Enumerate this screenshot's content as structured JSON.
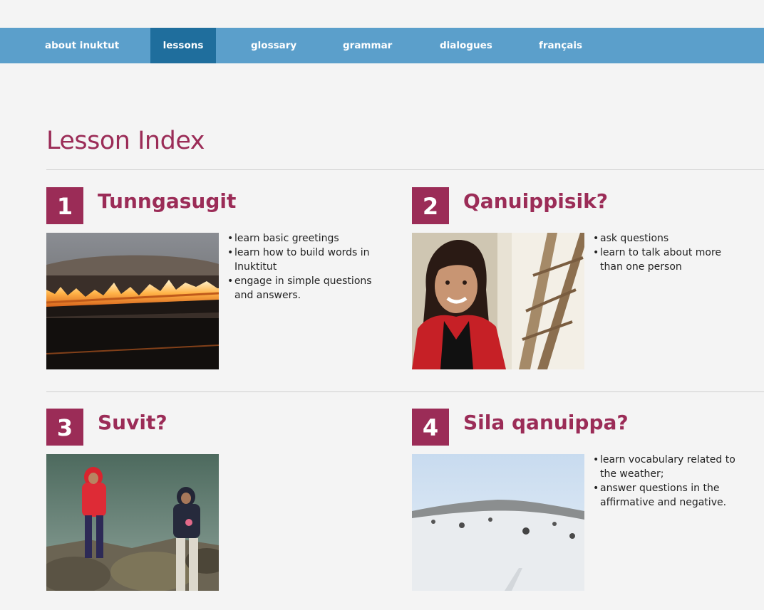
{
  "nav": {
    "items": [
      {
        "label": "about inuktut",
        "active": false
      },
      {
        "label": "lessons",
        "active": true
      },
      {
        "label": "glossary",
        "active": false
      },
      {
        "label": "grammar",
        "active": false
      },
      {
        "label": "dialogues",
        "active": false
      },
      {
        "label": "français",
        "active": false
      }
    ]
  },
  "page": {
    "title": "Lesson Index"
  },
  "lessons": [
    {
      "number": "1",
      "title": "Tunngasugit",
      "image_icon": "flame-photo",
      "bullets": [
        "learn basic greetings",
        "learn how to build words in Inuktitut",
        "engage in simple questions and answers."
      ]
    },
    {
      "number": "2",
      "title": "Qanuippisik?",
      "image_icon": "woman-portrait-photo",
      "bullets": [
        "ask questions",
        "learn to talk about more than one person"
      ]
    },
    {
      "number": "3",
      "title": "Suvit?",
      "image_icon": "children-fishing-photo",
      "bullets": []
    },
    {
      "number": "4",
      "title": "Sila qanuippa?",
      "image_icon": "snowy-landscape-photo",
      "bullets": [
        "learn vocabulary related to the weather;",
        "answer questions in the affirmative and negative."
      ]
    }
  ],
  "colors": {
    "nav_bg": "#5b9fcb",
    "nav_active_bg": "#1f6e9d",
    "brand": "#9b2c57",
    "page_bg": "#f4f4f4"
  }
}
